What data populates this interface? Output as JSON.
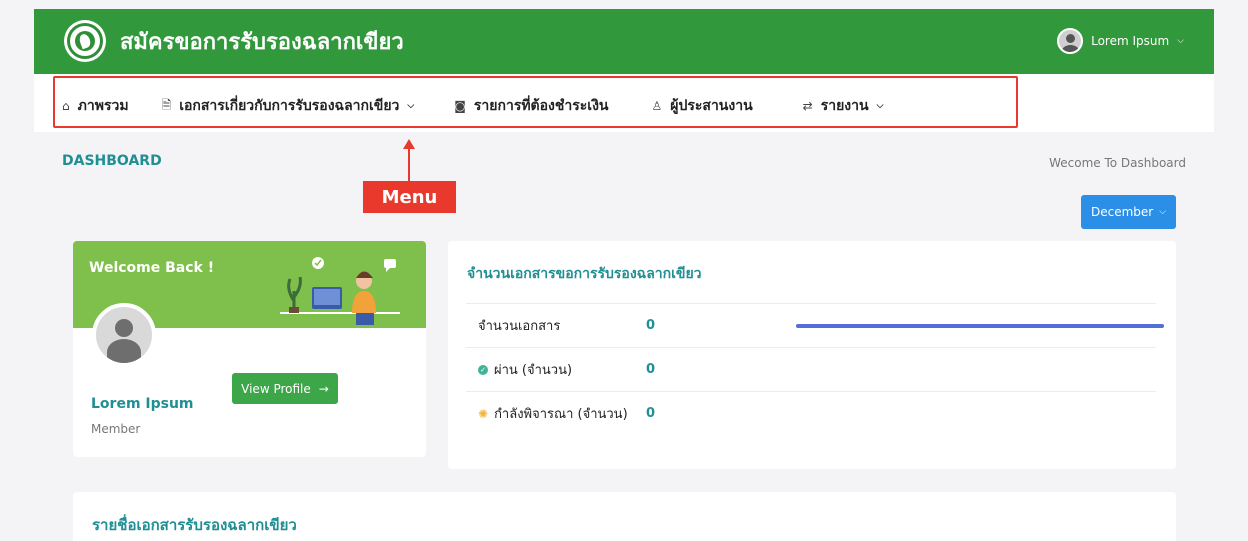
{
  "header": {
    "app_title": "สมัครขอการรับรองฉลากเขียว",
    "user_name": "Lorem Ipsum",
    "logo_icon": "green-label-logo"
  },
  "nav": {
    "items": [
      {
        "label": "ภาพรวม",
        "icon": "home-icon",
        "glyph": "⌂",
        "dropdown": false
      },
      {
        "label": "เอกสารเกี่ยวกับการรับรองฉลากเขียว",
        "icon": "document-icon",
        "glyph": "🗎",
        "dropdown": true
      },
      {
        "label": "รายการที่ต้องชำระเงิน",
        "icon": "money-icon",
        "glyph": "◙",
        "dropdown": false
      },
      {
        "label": "ผู้ประสานงาน",
        "icon": "user-icon",
        "glyph": "♙",
        "dropdown": false
      },
      {
        "label": "รายงาน",
        "icon": "report-icon",
        "glyph": "⇄",
        "dropdown": true
      }
    ]
  },
  "annotation": {
    "label": "Menu",
    "color": "#e8392c"
  },
  "page": {
    "title": "DASHBOARD",
    "welcome": "Wecome To Dashboard",
    "month": "December"
  },
  "profile": {
    "welcome_back": "Welcome Back !",
    "name": "Lorem Ipsum",
    "role": "Member",
    "button": "View Profile"
  },
  "stats": {
    "title": "จำนวนเอกสารขอการรับรองฉลากเขียว",
    "rows": [
      {
        "label": "จำนวนเอกสาร",
        "value": "0",
        "icon": ""
      },
      {
        "label": "ผ่าน (จำนวน)",
        "value": "0",
        "icon": "check-circle-icon"
      },
      {
        "label": "กำลังพิจารณา (จำนวน)",
        "value": "0",
        "icon": "spinner-icon"
      }
    ],
    "progress": 1.0
  },
  "list": {
    "title": "รายชื่อเอกสารรับรองฉลากเขียว"
  },
  "colors": {
    "header_green": "#31993b",
    "accent_teal": "#1f8f93",
    "button_blue": "#2b8fe8",
    "button_green": "#3da648",
    "progress": "#5470d8"
  }
}
